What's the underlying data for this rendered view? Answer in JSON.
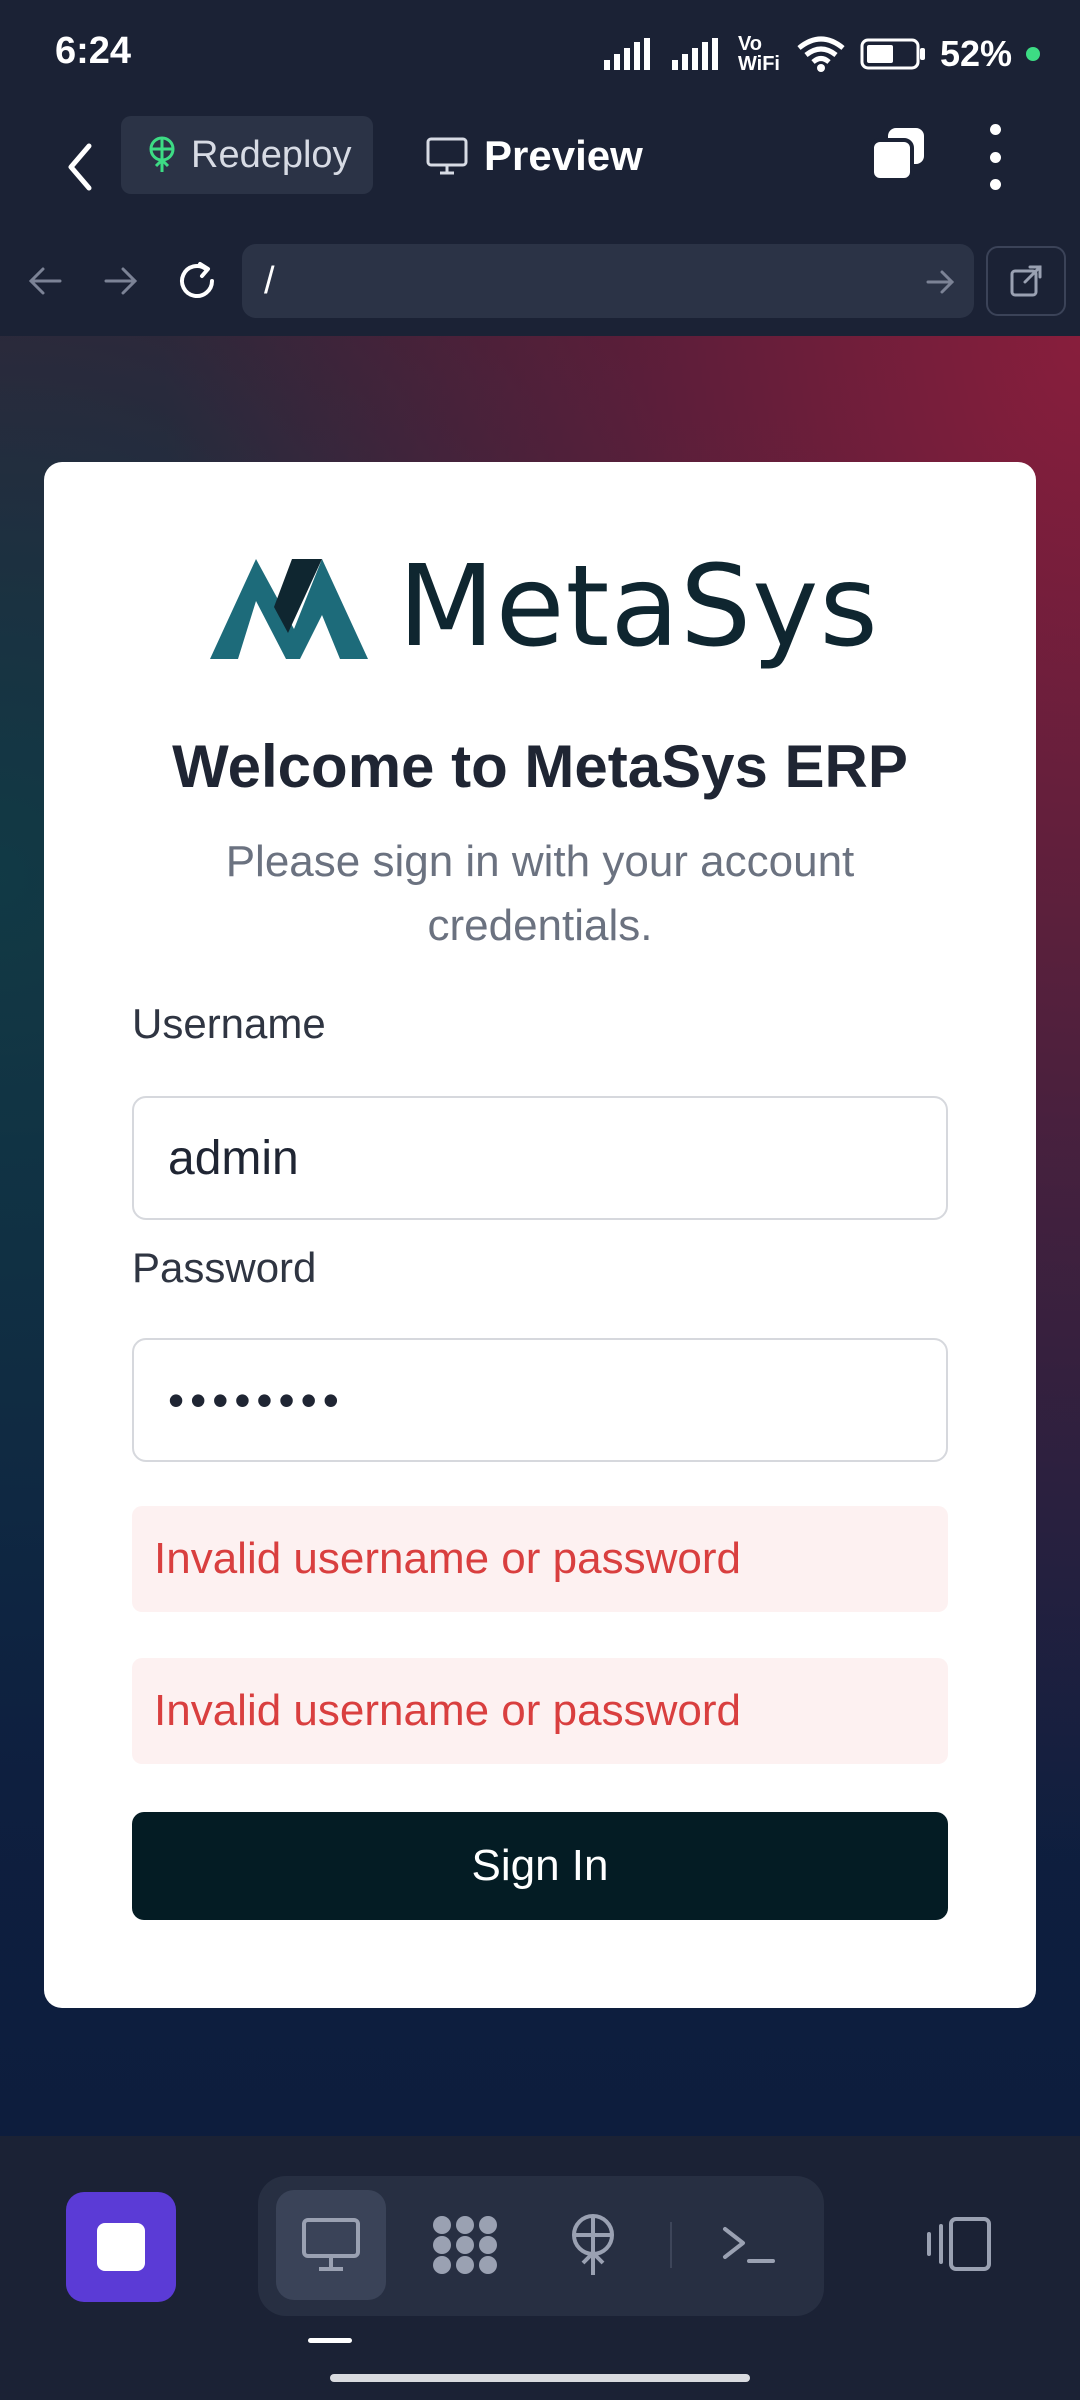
{
  "status_bar": {
    "time": "6:24",
    "network_label": "Vo WiFi",
    "battery": "52%"
  },
  "toolbar": {
    "redeploy_label": "Redeploy",
    "preview_label": "Preview"
  },
  "browser": {
    "url": "/"
  },
  "login": {
    "logo_text": "MetaSys",
    "title": "Welcome to MetaSys ERP",
    "subtitle": "Please sign in with your account credentials.",
    "username_label": "Username",
    "username_value": "admin",
    "password_label": "Password",
    "password_value": "••••••••",
    "errors": [
      "Invalid username or password",
      "Invalid username or password"
    ],
    "signin_label": "Sign In"
  },
  "colors": {
    "accent_purple": "#5b3bd6",
    "brand_teal": "#1d6b7a",
    "error_red": "#d93f3f",
    "button_dark": "#041c24"
  }
}
